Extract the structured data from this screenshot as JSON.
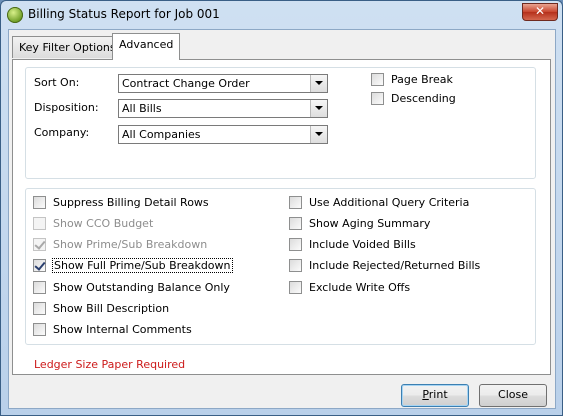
{
  "window": {
    "title": "Billing Status Report for Job 001",
    "close_label": "✕"
  },
  "tabs": [
    {
      "label": "Key Filter Options",
      "active": false
    },
    {
      "label": "Advanced",
      "active": true
    }
  ],
  "sort_group": {
    "sort_on": {
      "label": "Sort On:",
      "value": "Contract Change Order"
    },
    "disposition": {
      "label": "Disposition:",
      "value": "All Bills"
    },
    "company": {
      "label": "Company:",
      "value": "All Companies"
    },
    "page_break": {
      "label": "Page Break",
      "checked": false
    },
    "descending": {
      "label": "Descending",
      "checked": false
    }
  },
  "options_left": [
    {
      "label": "Suppress Billing Detail Rows",
      "checked": false,
      "enabled": true
    },
    {
      "label": "Show CCO Budget",
      "checked": false,
      "enabled": false
    },
    {
      "label": "Show Prime/Sub Breakdown",
      "checked": true,
      "enabled": false
    },
    {
      "label": "Show Full Prime/Sub Breakdown",
      "checked": true,
      "enabled": true,
      "focused": true
    },
    {
      "label": "Show Outstanding Balance Only",
      "checked": false,
      "enabled": true
    },
    {
      "label": "Show Bill Description",
      "checked": false,
      "enabled": true
    },
    {
      "label": "Show Internal Comments",
      "checked": false,
      "enabled": true
    }
  ],
  "options_right": [
    {
      "label": "Use Additional Query Criteria",
      "checked": false,
      "enabled": true
    },
    {
      "label": "Show Aging Summary",
      "checked": false,
      "enabled": true
    },
    {
      "label": "Include Voided Bills",
      "checked": false,
      "enabled": true
    },
    {
      "label": "Include Rejected/Returned Bills",
      "checked": false,
      "enabled": true
    },
    {
      "label": "Exclude Write Offs",
      "checked": false,
      "enabled": true
    }
  ],
  "warning_text": "Ledger Size Paper Required",
  "buttons": {
    "print": {
      "accel": "P",
      "rest": "rint"
    },
    "close": "Close"
  }
}
